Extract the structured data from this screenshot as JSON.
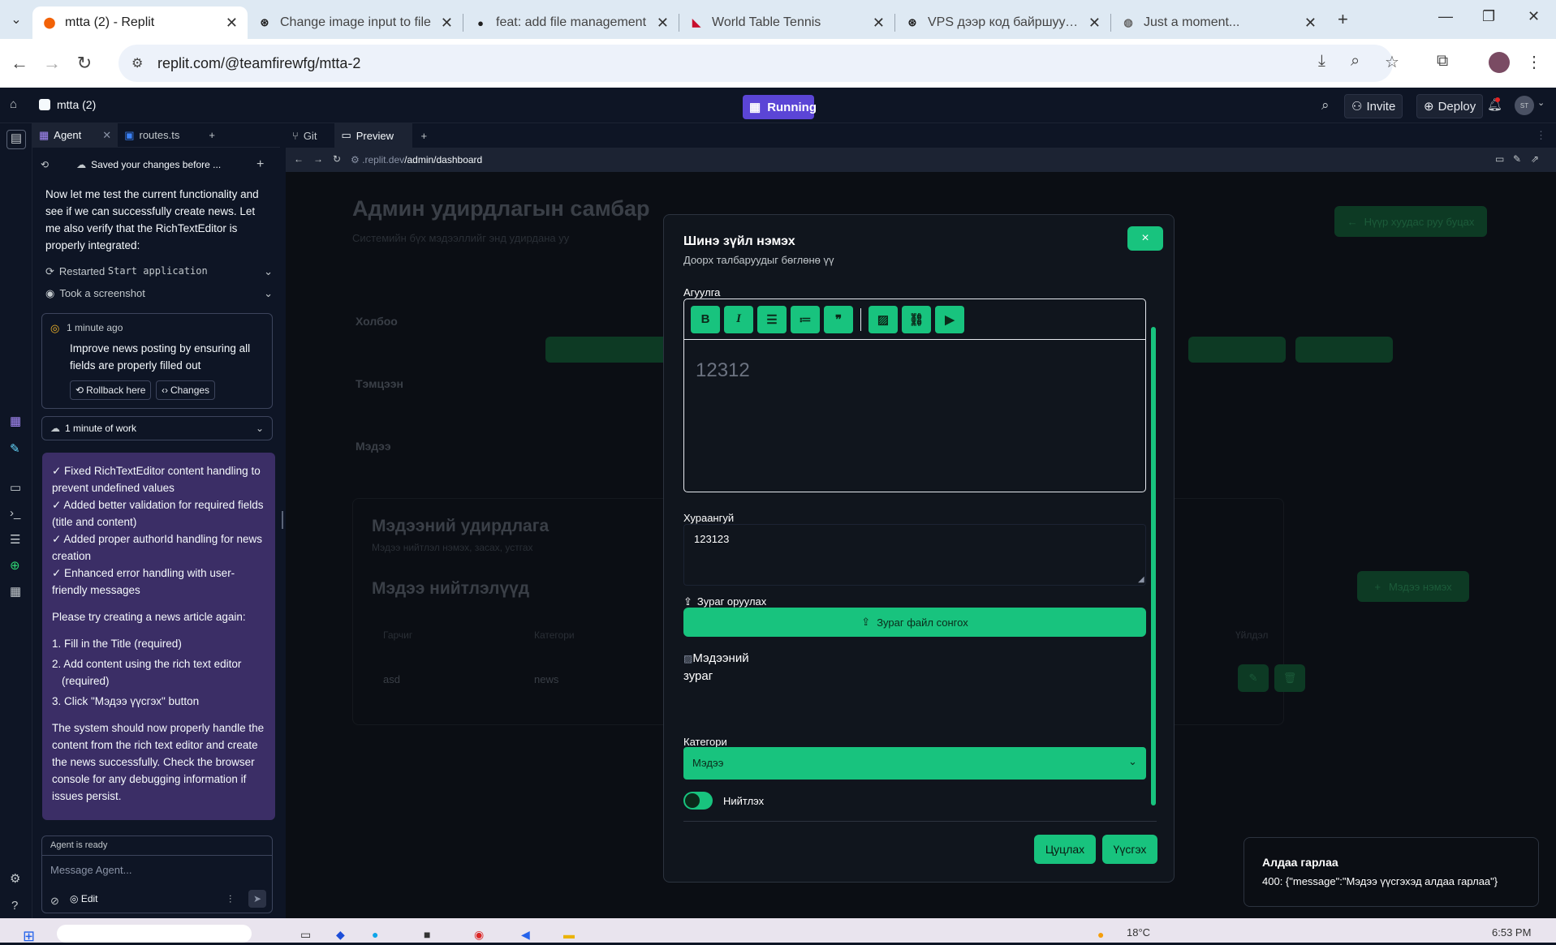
{
  "browser": {
    "tabs": [
      {
        "title": "mtta (2) - Replit",
        "icon": "replit-icon",
        "active": true
      },
      {
        "title": "Change image input to file",
        "icon": "chatgpt-icon"
      },
      {
        "title": "feat: add file management",
        "icon": "github-icon"
      },
      {
        "title": "World Table Tennis",
        "icon": "wtt-icon"
      },
      {
        "title": "VPS дээр код байршуулах",
        "icon": "chatgpt-icon"
      },
      {
        "title": "Just a moment...",
        "icon": "globe-icon"
      }
    ],
    "url": "replit.com/@teamfirewfg/mtta-2"
  },
  "replit": {
    "project": "mtta (2)",
    "status": "Running",
    "invite": "Invite",
    "deploy": "Deploy",
    "avatar": "ST"
  },
  "left_tabs": [
    "Agent",
    "routes.ts",
    "+"
  ],
  "agent": {
    "header": "Saved your changes before ...",
    "intro": "Now let me test the current functionality and see if we can successfully create news. Let me also verify that the RichTextEditor is properly integrated:",
    "actions": [
      {
        "label": "Restarted",
        "code": "Start application"
      },
      {
        "label": "Took a screenshot",
        "code": ""
      }
    ],
    "checkpoint": {
      "time": "1 minute ago",
      "text": "Improve news posting by ensuring all fields are properly filled out",
      "rollback": "Rollback here",
      "changes": "Changes"
    },
    "work": "1 minute of work",
    "fixes": [
      "✓ Fixed RichTextEditor content handling to prevent undefined values",
      "✓ Added better validation for required fields (title and content)",
      "✓ Added proper authorId handling for news creation",
      "✓ Enhanced error handling with user-friendly messages"
    ],
    "retry": "Please try creating a news article again:",
    "steps": [
      "1. Fill in the Title (required)",
      "2. Add content using the rich text editor (required)",
      "3. Click \"Мэдээ үүсгэх\" button"
    ],
    "closing": "The system should now properly handle the content from the rich text editor and create the news successfully. Check the browser console for any debugging information if issues persist.",
    "ready": "Agent is ready",
    "placeholder": "Message Agent...",
    "edit": "Edit"
  },
  "right_tabs": [
    "Git",
    "Preview",
    "+"
  ],
  "preview_url_prefix": ".replit.dev",
  "preview_url_path": "/admin/dashboard",
  "page": {
    "title": "Админ удирдлагын самбар",
    "subtitle": "Системийн бүх мэдээллийг энд удирдана уу",
    "back": "Нүүр хуудас руу буцах",
    "rows": [
      "Холбоо",
      "Тэмцээн",
      "Мэдээ"
    ],
    "news_title": "Мэдээний удирдлага",
    "news_sub": "Мэдээ нийтлэл нэмэх, засах, устгах",
    "list_title": "Мэдээ нийтлэлүүд",
    "add_news": "Мэдээ нэмэх",
    "th": [
      "Гарчиг",
      "Категори",
      "Үйлдэл"
    ],
    "row": [
      "asd",
      "news"
    ]
  },
  "modal": {
    "title": "Шинэ зүйл нэмэх",
    "subtitle": "Доорх талбаруудыг бөглөнө үү",
    "close": "×",
    "content_label": "Агуулга",
    "content_value": "12312",
    "summary_label": "Хураангуй",
    "summary_value": "123123",
    "image_label": "Зураг оруулах",
    "image_button": "Зураг файл сонгох",
    "image_alt": "Мэдээний зураг",
    "category_label": "Категори",
    "category_value": "Мэдээ",
    "publish_label": "Нийтлэх",
    "cancel": "Цуцлах",
    "create": "Үүсгэх"
  },
  "toast": {
    "title": "Алдаа гарлаа",
    "message": "400: {\"message\":\"Мэдээ үүсгэхэд алдаа гарлаа\"}"
  },
  "taskbar": {
    "temp": "18°C",
    "time": "6:53 PM"
  }
}
